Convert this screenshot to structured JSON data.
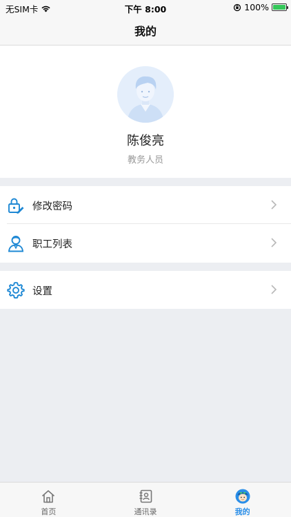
{
  "status_bar": {
    "carrier": "无SIM卡",
    "time": "下午 8:00",
    "battery": "100%",
    "battery_level": 1.0
  },
  "nav": {
    "title": "我的"
  },
  "profile": {
    "name": "陈俊亮",
    "role": "教务人员"
  },
  "menu": {
    "items": [
      {
        "label": "修改密码",
        "icon": "lock-edit-icon"
      },
      {
        "label": "职工列表",
        "icon": "staff-icon"
      },
      {
        "label": "设置",
        "icon": "gear-icon"
      }
    ]
  },
  "tabs": [
    {
      "label": "首页",
      "icon": "home-icon",
      "active": false
    },
    {
      "label": "通讯录",
      "icon": "contacts-icon",
      "active": false
    },
    {
      "label": "我的",
      "icon": "me-avatar-icon",
      "active": true
    }
  ],
  "colors": {
    "accent": "#2a8ee8",
    "background": "#eceef2",
    "icon_blue": "#1e88d4"
  }
}
